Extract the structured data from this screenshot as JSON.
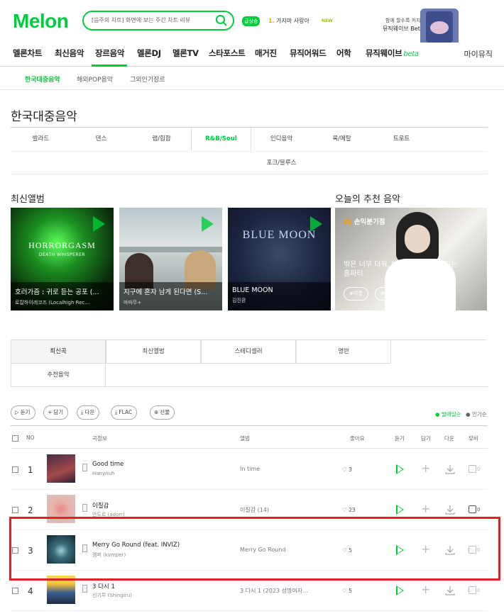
{
  "header": {
    "logo": "Melon",
    "search_placeholder": "[음주의 차트] 화면에 보는 주간 차트 리뷰",
    "hot_badge": "급상승",
    "hot_rank_num": "1.",
    "hot_rank_text": "가지마 사랑아",
    "new_tag": "NEW",
    "promo_line1": "함께 할수록 커지는 재미",
    "promo_line2": "뮤직웨이브 Beta 오픈"
  },
  "gnb": {
    "items": [
      "멜론차트",
      "최신음악",
      "장르음악",
      "멜론DJ",
      "멜론TV",
      "스타포스트",
      "매거진",
      "뮤직어워드",
      "어학",
      "뮤직웨이브"
    ],
    "beta": "beta",
    "right": "마이뮤직"
  },
  "subnav": [
    "한국대중음악",
    "해외POP음악",
    "그외인기장르"
  ],
  "page_title": "한국대중음악",
  "genres_row1": [
    "발라드",
    "댄스",
    "랩/힙합",
    "R&B/Soul",
    "인디음악",
    "록/메탈",
    "트로트"
  ],
  "genres_row2": [
    "포크/블루스"
  ],
  "latest_title": "최신앨범",
  "recommend_title": "오늘의 추천 음악",
  "albums": [
    {
      "name": "호러가즘 : 귀로 듣는 공포 (...",
      "artist": "로칼하이레코즈 (Localhigh Rec...",
      "cover_text": "HORRORGASM",
      "cover_sub": "DEATH WHISPERER"
    },
    {
      "name": "지구에 혼자 남게 된다면 (S...",
      "artist": "마마무+"
    },
    {
      "name": "BLUE MOON",
      "artist": "김진환",
      "cover_text": "BLUE MOON"
    }
  ],
  "dj": {
    "tag_prefix": "DJ",
    "tag": "손익분기점",
    "title": "밖은 너무 더워, 나 홀로 집에서 즐기는 홈파티",
    "chips": [
      "#여름",
      "#홈파티"
    ]
  },
  "tabs_row1": [
    "최신곡",
    "최신앨범",
    "스테디셀러",
    "명반"
  ],
  "tabs_row2": [
    "추천음악"
  ],
  "actions": {
    "play": "듣기",
    "add": "담기",
    "download": "다운",
    "flac": "FLAC",
    "gift": "선물"
  },
  "sort": {
    "on": "발매일순",
    "off": "인기순"
  },
  "columns": {
    "no": "NO",
    "song": "곡정보",
    "album": "앨범",
    "like": "좋아요",
    "play": "듣기",
    "add": "담기",
    "down": "다운",
    "mv": "뮤비"
  },
  "rows": [
    {
      "rank": "1",
      "title": "Good time",
      "artist": "Hanynuh",
      "album": "In time",
      "likes": "3",
      "mv": "0"
    },
    {
      "rank": "2",
      "title": "이질감",
      "artist": "안도르 (adorr)",
      "album": "이질감 (14)",
      "likes": "23",
      "mv": "0"
    },
    {
      "rank": "3",
      "title": "Merry Go Round (feat. INVIZ)",
      "artist": "켐퍼 (kvmper)",
      "album": "Merry Go Round",
      "likes": "5",
      "mv": "0"
    },
    {
      "rank": "4",
      "title": "3 다시 1",
      "artist": "신기루 (Shingiru)",
      "album": "3 다시 1 (2023 성명여자...",
      "likes": "5",
      "mv": "0"
    }
  ],
  "colors": {
    "brand": "#00cd3c",
    "highlight": "#e0212a"
  }
}
